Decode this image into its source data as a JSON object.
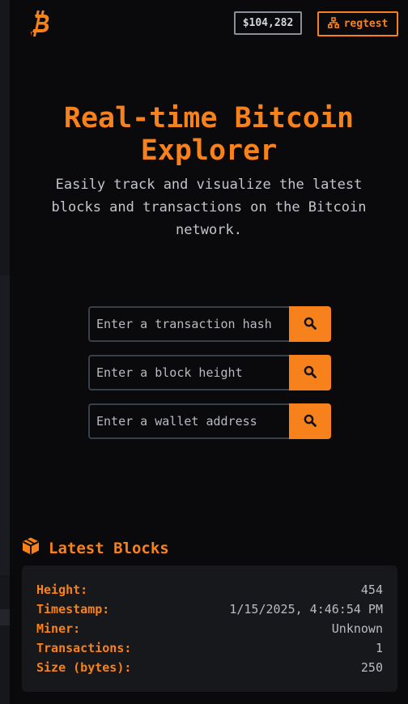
{
  "header": {
    "logo_icon": "bitcoin-logo-icon",
    "price": "$104,282",
    "network_icon": "network-icon",
    "network": "regtest"
  },
  "hero": {
    "title": "Real-time Bitcoin Explorer",
    "subtitle": "Easily track and visualize the latest blocks and transactions on the Bitcoin network."
  },
  "search": {
    "transaction": {
      "placeholder": "Enter a transaction hash",
      "value": ""
    },
    "block": {
      "placeholder": "Enter a block height",
      "value": ""
    },
    "wallet": {
      "placeholder": "Enter a wallet address",
      "value": ""
    },
    "button_icon": "search-icon"
  },
  "latest_blocks": {
    "icon": "cube-icon",
    "title": "Latest Blocks",
    "block": {
      "height_label": "Height:",
      "height": "454",
      "timestamp_label": "Timestamp:",
      "timestamp": "1/15/2025, 4:46:54 PM",
      "miner_label": "Miner:",
      "miner": "Unknown",
      "transactions_label": "Transactions:",
      "transactions": "1",
      "size_label": "Size (bytes):",
      "size": "250"
    }
  },
  "colors": {
    "accent": "#f7811a",
    "background": "#0a0a0c",
    "card": "#17181c"
  }
}
